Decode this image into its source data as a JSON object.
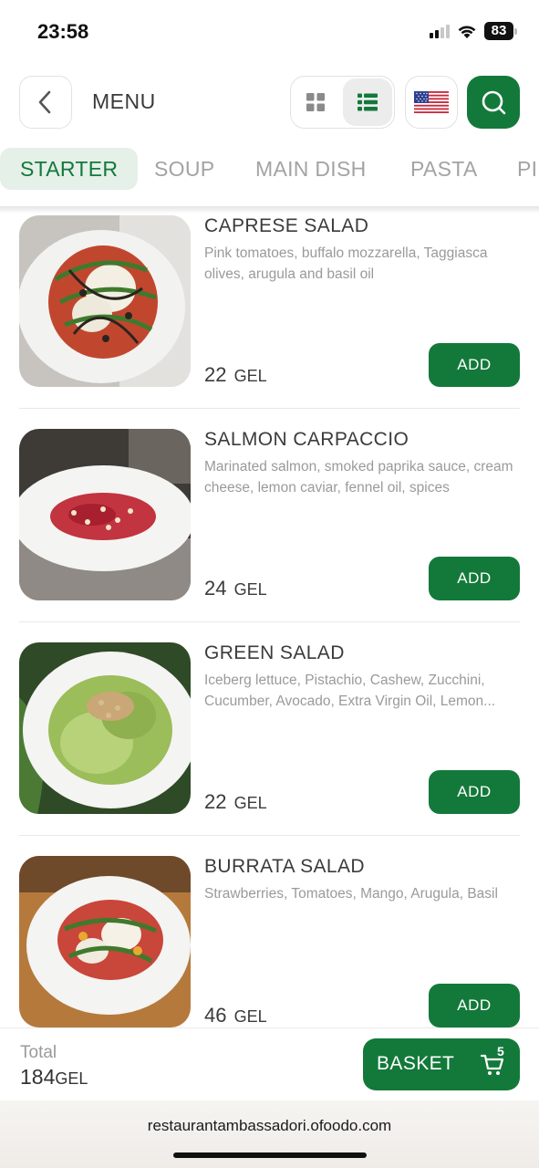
{
  "status_bar": {
    "time": "23:58",
    "battery": "83",
    "icons": [
      "signal-icon",
      "wifi-icon",
      "battery-icon"
    ]
  },
  "header": {
    "title": "MENU",
    "icons": [
      "chevron-left-icon",
      "grid-view-icon",
      "list-view-icon",
      "us-flag-icon",
      "search-icon"
    ],
    "active_view": "list"
  },
  "tabs": [
    {
      "label": "STARTER",
      "active": true
    },
    {
      "label": "SOUP",
      "active": false
    },
    {
      "label": "MAIN DISH",
      "active": false
    },
    {
      "label": "PASTA",
      "active": false
    },
    {
      "label": "PI",
      "active": false
    }
  ],
  "items": [
    {
      "name": "CAPRESE SALAD",
      "description": "Pink tomatoes, buffalo mozzarella, Taggiasca olives, arugula and basil oil",
      "price": "22",
      "currency": "GEL",
      "add_label": "ADD"
    },
    {
      "name": "SALMON CARPACCIO",
      "description": "Marinated salmon, smoked paprika sauce, cream cheese, lemon caviar, fennel oil, spices",
      "price": "24",
      "currency": "GEL",
      "add_label": "ADD"
    },
    {
      "name": "GREEN SALAD",
      "description": "Iceberg lettuce, Pistachio, Cashew, Zucchini, Cucumber, Avocado, Extra Virgin Oil, Lemon...",
      "price": "22",
      "currency": "GEL",
      "add_label": "ADD"
    },
    {
      "name": "BURRATA SALAD",
      "description": "Strawberries, Tomatoes, Mango, Arugula, Basil",
      "price": "46",
      "currency": "GEL",
      "add_label": "ADD"
    }
  ],
  "footer": {
    "total_label": "Total",
    "total_value": "184",
    "total_currency": "GEL",
    "basket_label": "BASKET",
    "basket_count": "5"
  },
  "browser": {
    "url": "restaurantambassadori.ofoodo.com"
  },
  "colors": {
    "accent": "#13793a",
    "accent_light": "#e5f0e8",
    "muted_text": "#9a9a9a"
  }
}
